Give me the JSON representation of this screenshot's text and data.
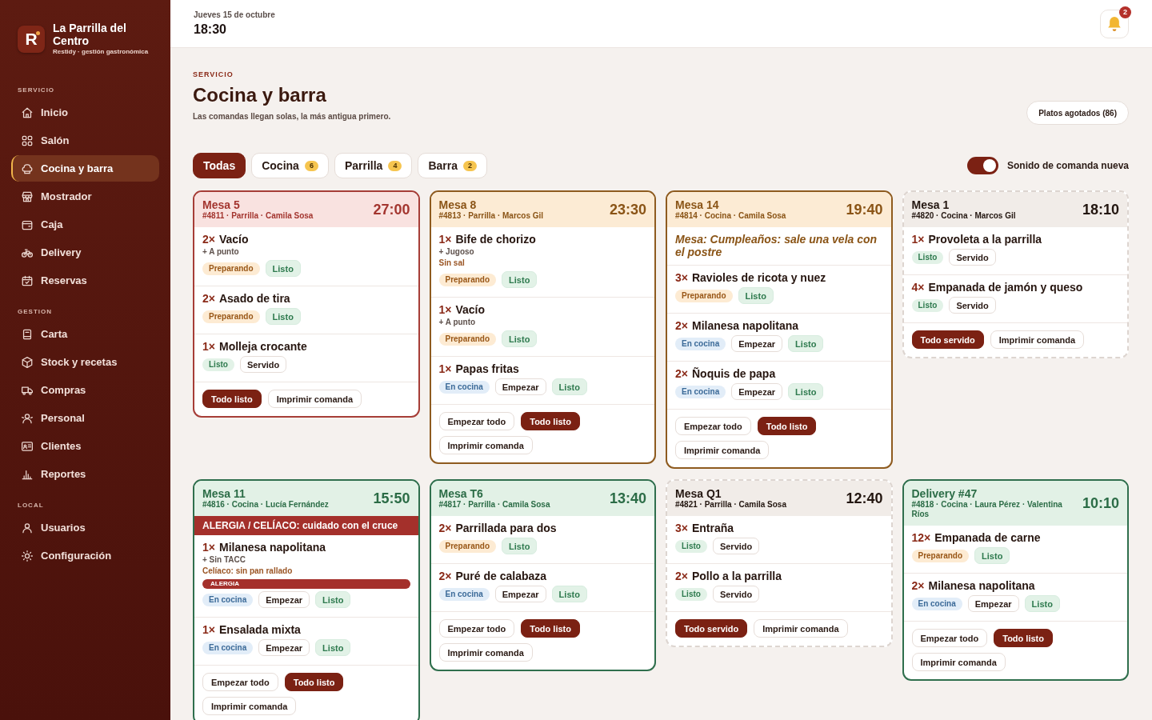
{
  "sidebar": {
    "brand": {
      "logo_letter": "R",
      "name": "La Parrilla del Centro",
      "tagline": "Restidy · gestión gastronómica"
    },
    "sections": [
      {
        "title": "SERVICIO",
        "items": [
          {
            "label": "Inicio",
            "selected": false
          },
          {
            "label": "Salón",
            "selected": false
          },
          {
            "label": "Cocina y barra",
            "selected": true
          },
          {
            "label": "Mostrador",
            "selected": false
          },
          {
            "label": "Caja",
            "selected": false
          },
          {
            "label": "Delivery",
            "selected": false
          },
          {
            "label": "Reservas",
            "selected": false
          }
        ]
      },
      {
        "title": "GESTION",
        "items": [
          {
            "label": "Carta",
            "selected": false
          },
          {
            "label": "Stock y recetas",
            "selected": false
          },
          {
            "label": "Compras",
            "selected": false
          },
          {
            "label": "Personal",
            "selected": false
          },
          {
            "label": "Clientes",
            "selected": false
          },
          {
            "label": "Reportes",
            "selected": false
          }
        ]
      },
      {
        "title": "LOCAL",
        "items": [
          {
            "label": "Usuarios",
            "selected": false
          },
          {
            "label": "Configuración",
            "selected": false
          }
        ]
      }
    ]
  },
  "top_bar": {
    "date": "Jueves 15 de octubre",
    "time": "18:30",
    "notification_count": "2"
  },
  "header": {
    "eyebrow": "SERVICIO",
    "title": "Cocina y barra",
    "subtitle": "Las comandas llegan solas, la más antigua primero.",
    "sold_out_button": "Platos agotados (86)"
  },
  "filters": [
    {
      "label": "Todas",
      "selected": true
    },
    {
      "label": "Cocina",
      "count": "6",
      "selected": false
    },
    {
      "label": "Parrilla",
      "count": "4",
      "selected": false
    },
    {
      "label": "Barra",
      "count": "2",
      "selected": false
    }
  ],
  "sound_toggle": {
    "label": "Sonido de comanda nueva",
    "on": true
  },
  "tickets": [
    {
      "kind": "late",
      "title": "Mesa 5",
      "meta": "#4811 · Parrilla · Camila Sosa",
      "timer": "27:00",
      "items": [
        {
          "qty": "2×",
          "name": "Vacío",
          "modifiers": [
            "+ A punto"
          ],
          "status": {
            "kind": "preparing",
            "label": "Preparando"
          },
          "actions": [
            {
              "kind": "ready",
              "label": "Listo"
            }
          ]
        },
        {
          "qty": "2×",
          "name": "Asado de tira",
          "status": {
            "kind": "preparing",
            "label": "Preparando"
          },
          "actions": [
            {
              "kind": "ready",
              "label": "Listo"
            }
          ]
        },
        {
          "qty": "1×",
          "name": "Molleja crocante",
          "status": {
            "kind": "ready",
            "label": "Listo"
          },
          "actions": [
            {
              "kind": "serve",
              "label": "Servido"
            }
          ]
        }
      ],
      "footer": [
        {
          "kind": "all-ready",
          "label": "Todo listo"
        },
        {
          "kind": "print",
          "label": "Imprimir comanda"
        }
      ]
    },
    {
      "kind": "warning",
      "title": "Mesa 8",
      "meta": "#4813 · Parrilla · Marcos Gil",
      "timer": "23:30",
      "items": [
        {
          "qty": "1×",
          "name": "Bife de chorizo",
          "modifiers": [
            "+ Jugoso"
          ],
          "note": "Sin sal",
          "status": {
            "kind": "preparing",
            "label": "Preparando"
          },
          "actions": [
            {
              "kind": "ready",
              "label": "Listo"
            }
          ]
        },
        {
          "qty": "1×",
          "name": "Vacío",
          "modifiers": [
            "+ A punto"
          ],
          "status": {
            "kind": "preparing",
            "label": "Preparando"
          },
          "actions": [
            {
              "kind": "ready",
              "label": "Listo"
            }
          ]
        },
        {
          "qty": "1×",
          "name": "Papas fritas",
          "status": {
            "kind": "queued",
            "label": "En cocina"
          },
          "actions": [
            {
              "kind": "start",
              "label": "Empezar"
            },
            {
              "kind": "ready",
              "label": "Listo"
            }
          ]
        }
      ],
      "footer": [
        {
          "kind": "start-all",
          "label": "Empezar todo"
        },
        {
          "kind": "all-ready",
          "label": "Todo listo"
        },
        {
          "kind": "print",
          "label": "Imprimir comanda"
        }
      ]
    },
    {
      "kind": "warning",
      "title": "Mesa 14",
      "meta": "#4814 · Cocina · Camila Sosa",
      "timer": "19:40",
      "note": "Mesa: Cumpleaños: sale una vela con el postre",
      "items": [
        {
          "qty": "3×",
          "name": "Ravioles de ricota y nuez",
          "status": {
            "kind": "preparing",
            "label": "Preparando"
          },
          "actions": [
            {
              "kind": "ready",
              "label": "Listo"
            }
          ]
        },
        {
          "qty": "2×",
          "name": "Milanesa napolitana",
          "status": {
            "kind": "queued",
            "label": "En cocina"
          },
          "actions": [
            {
              "kind": "start",
              "label": "Empezar"
            },
            {
              "kind": "ready",
              "label": "Listo"
            }
          ]
        },
        {
          "qty": "2×",
          "name": "Ñoquis de papa",
          "status": {
            "kind": "queued",
            "label": "En cocina"
          },
          "actions": [
            {
              "kind": "start",
              "label": "Empezar"
            },
            {
              "kind": "ready",
              "label": "Listo"
            }
          ]
        }
      ],
      "footer": [
        {
          "kind": "start-all",
          "label": "Empezar todo"
        },
        {
          "kind": "all-ready",
          "label": "Todo listo"
        },
        {
          "kind": "print",
          "label": "Imprimir comanda"
        }
      ]
    },
    {
      "kind": "served",
      "title": "Mesa 1",
      "meta": "#4820 · Cocina · Marcos Gil",
      "timer": "18:10",
      "items": [
        {
          "qty": "1×",
          "name": "Provoleta a la parrilla",
          "status": {
            "kind": "ready",
            "label": "Listo"
          },
          "actions": [
            {
              "kind": "serve",
              "label": "Servido"
            }
          ]
        },
        {
          "qty": "4×",
          "name": "Empanada de jamón y queso",
          "status": {
            "kind": "ready",
            "label": "Listo"
          },
          "actions": [
            {
              "kind": "serve",
              "label": "Servido"
            }
          ]
        }
      ],
      "footer": [
        {
          "kind": "all-served",
          "label": "Todo servido"
        },
        {
          "kind": "print",
          "label": "Imprimir comanda"
        }
      ]
    },
    {
      "kind": "fresh",
      "title": "Mesa 11",
      "meta": "#4816 · Cocina · Lucía Fernández",
      "timer": "15:50",
      "alert": "ALERGIA / CELÍACO: cuidado con el cruce",
      "items": [
        {
          "qty": "1×",
          "name": "Milanesa napolitana",
          "modifiers": [
            "+ Sin TACC"
          ],
          "note": "Celíaco: sin pan rallado",
          "tag": "ALERGIA",
          "status": {
            "kind": "queued",
            "label": "En cocina"
          },
          "actions": [
            {
              "kind": "start",
              "label": "Empezar"
            },
            {
              "kind": "ready",
              "label": "Listo"
            }
          ]
        },
        {
          "qty": "1×",
          "name": "Ensalada mixta",
          "status": {
            "kind": "queued",
            "label": "En cocina"
          },
          "actions": [
            {
              "kind": "start",
              "label": "Empezar"
            },
            {
              "kind": "ready",
              "label": "Listo"
            }
          ]
        }
      ],
      "footer": [
        {
          "kind": "start-all",
          "label": "Empezar todo"
        },
        {
          "kind": "all-ready",
          "label": "Todo listo"
        },
        {
          "kind": "print",
          "label": "Imprimir comanda"
        }
      ]
    },
    {
      "kind": "fresh",
      "title": "Mesa T6",
      "meta": "#4817 · Parrilla · Camila Sosa",
      "timer": "13:40",
      "items": [
        {
          "qty": "2×",
          "name": "Parrillada para dos",
          "status": {
            "kind": "preparing",
            "label": "Preparando"
          },
          "actions": [
            {
              "kind": "ready",
              "label": "Listo"
            }
          ]
        },
        {
          "qty": "2×",
          "name": "Puré de calabaza",
          "status": {
            "kind": "queued",
            "label": "En cocina"
          },
          "actions": [
            {
              "kind": "start",
              "label": "Empezar"
            },
            {
              "kind": "ready",
              "label": "Listo"
            }
          ]
        }
      ],
      "footer": [
        {
          "kind": "start-all",
          "label": "Empezar todo"
        },
        {
          "kind": "all-ready",
          "label": "Todo listo"
        },
        {
          "kind": "print",
          "label": "Imprimir comanda"
        }
      ]
    },
    {
      "kind": "served",
      "title": "Mesa Q1",
      "meta": "#4821 · Parrilla · Camila Sosa",
      "timer": "12:40",
      "items": [
        {
          "qty": "3×",
          "name": "Entraña",
          "status": {
            "kind": "ready",
            "label": "Listo"
          },
          "actions": [
            {
              "kind": "serve",
              "label": "Servido"
            }
          ]
        },
        {
          "qty": "2×",
          "name": "Pollo a la parrilla",
          "status": {
            "kind": "ready",
            "label": "Listo"
          },
          "actions": [
            {
              "kind": "serve",
              "label": "Servido"
            }
          ]
        }
      ],
      "footer": [
        {
          "kind": "all-served",
          "label": "Todo servido"
        },
        {
          "kind": "print",
          "label": "Imprimir comanda"
        }
      ]
    },
    {
      "kind": "fresh",
      "title": "Delivery #47",
      "meta": "#4818 · Cocina · Laura Pérez · Valentina Ríos",
      "timer": "10:10",
      "items": [
        {
          "qty": "12×",
          "name": "Empanada de carne",
          "status": {
            "kind": "preparing",
            "label": "Preparando"
          },
          "actions": [
            {
              "kind": "ready",
              "label": "Listo"
            }
          ]
        },
        {
          "qty": "2×",
          "name": "Milanesa napolitana",
          "status": {
            "kind": "queued",
            "label": "En cocina"
          },
          "actions": [
            {
              "kind": "start",
              "label": "Empezar"
            },
            {
              "kind": "ready",
              "label": "Listo"
            }
          ]
        }
      ],
      "footer": [
        {
          "kind": "start-all",
          "label": "Empezar todo"
        },
        {
          "kind": "all-ready",
          "label": "Todo listo"
        },
        {
          "kind": "print",
          "label": "Imprimir comanda"
        }
      ]
    }
  ]
}
